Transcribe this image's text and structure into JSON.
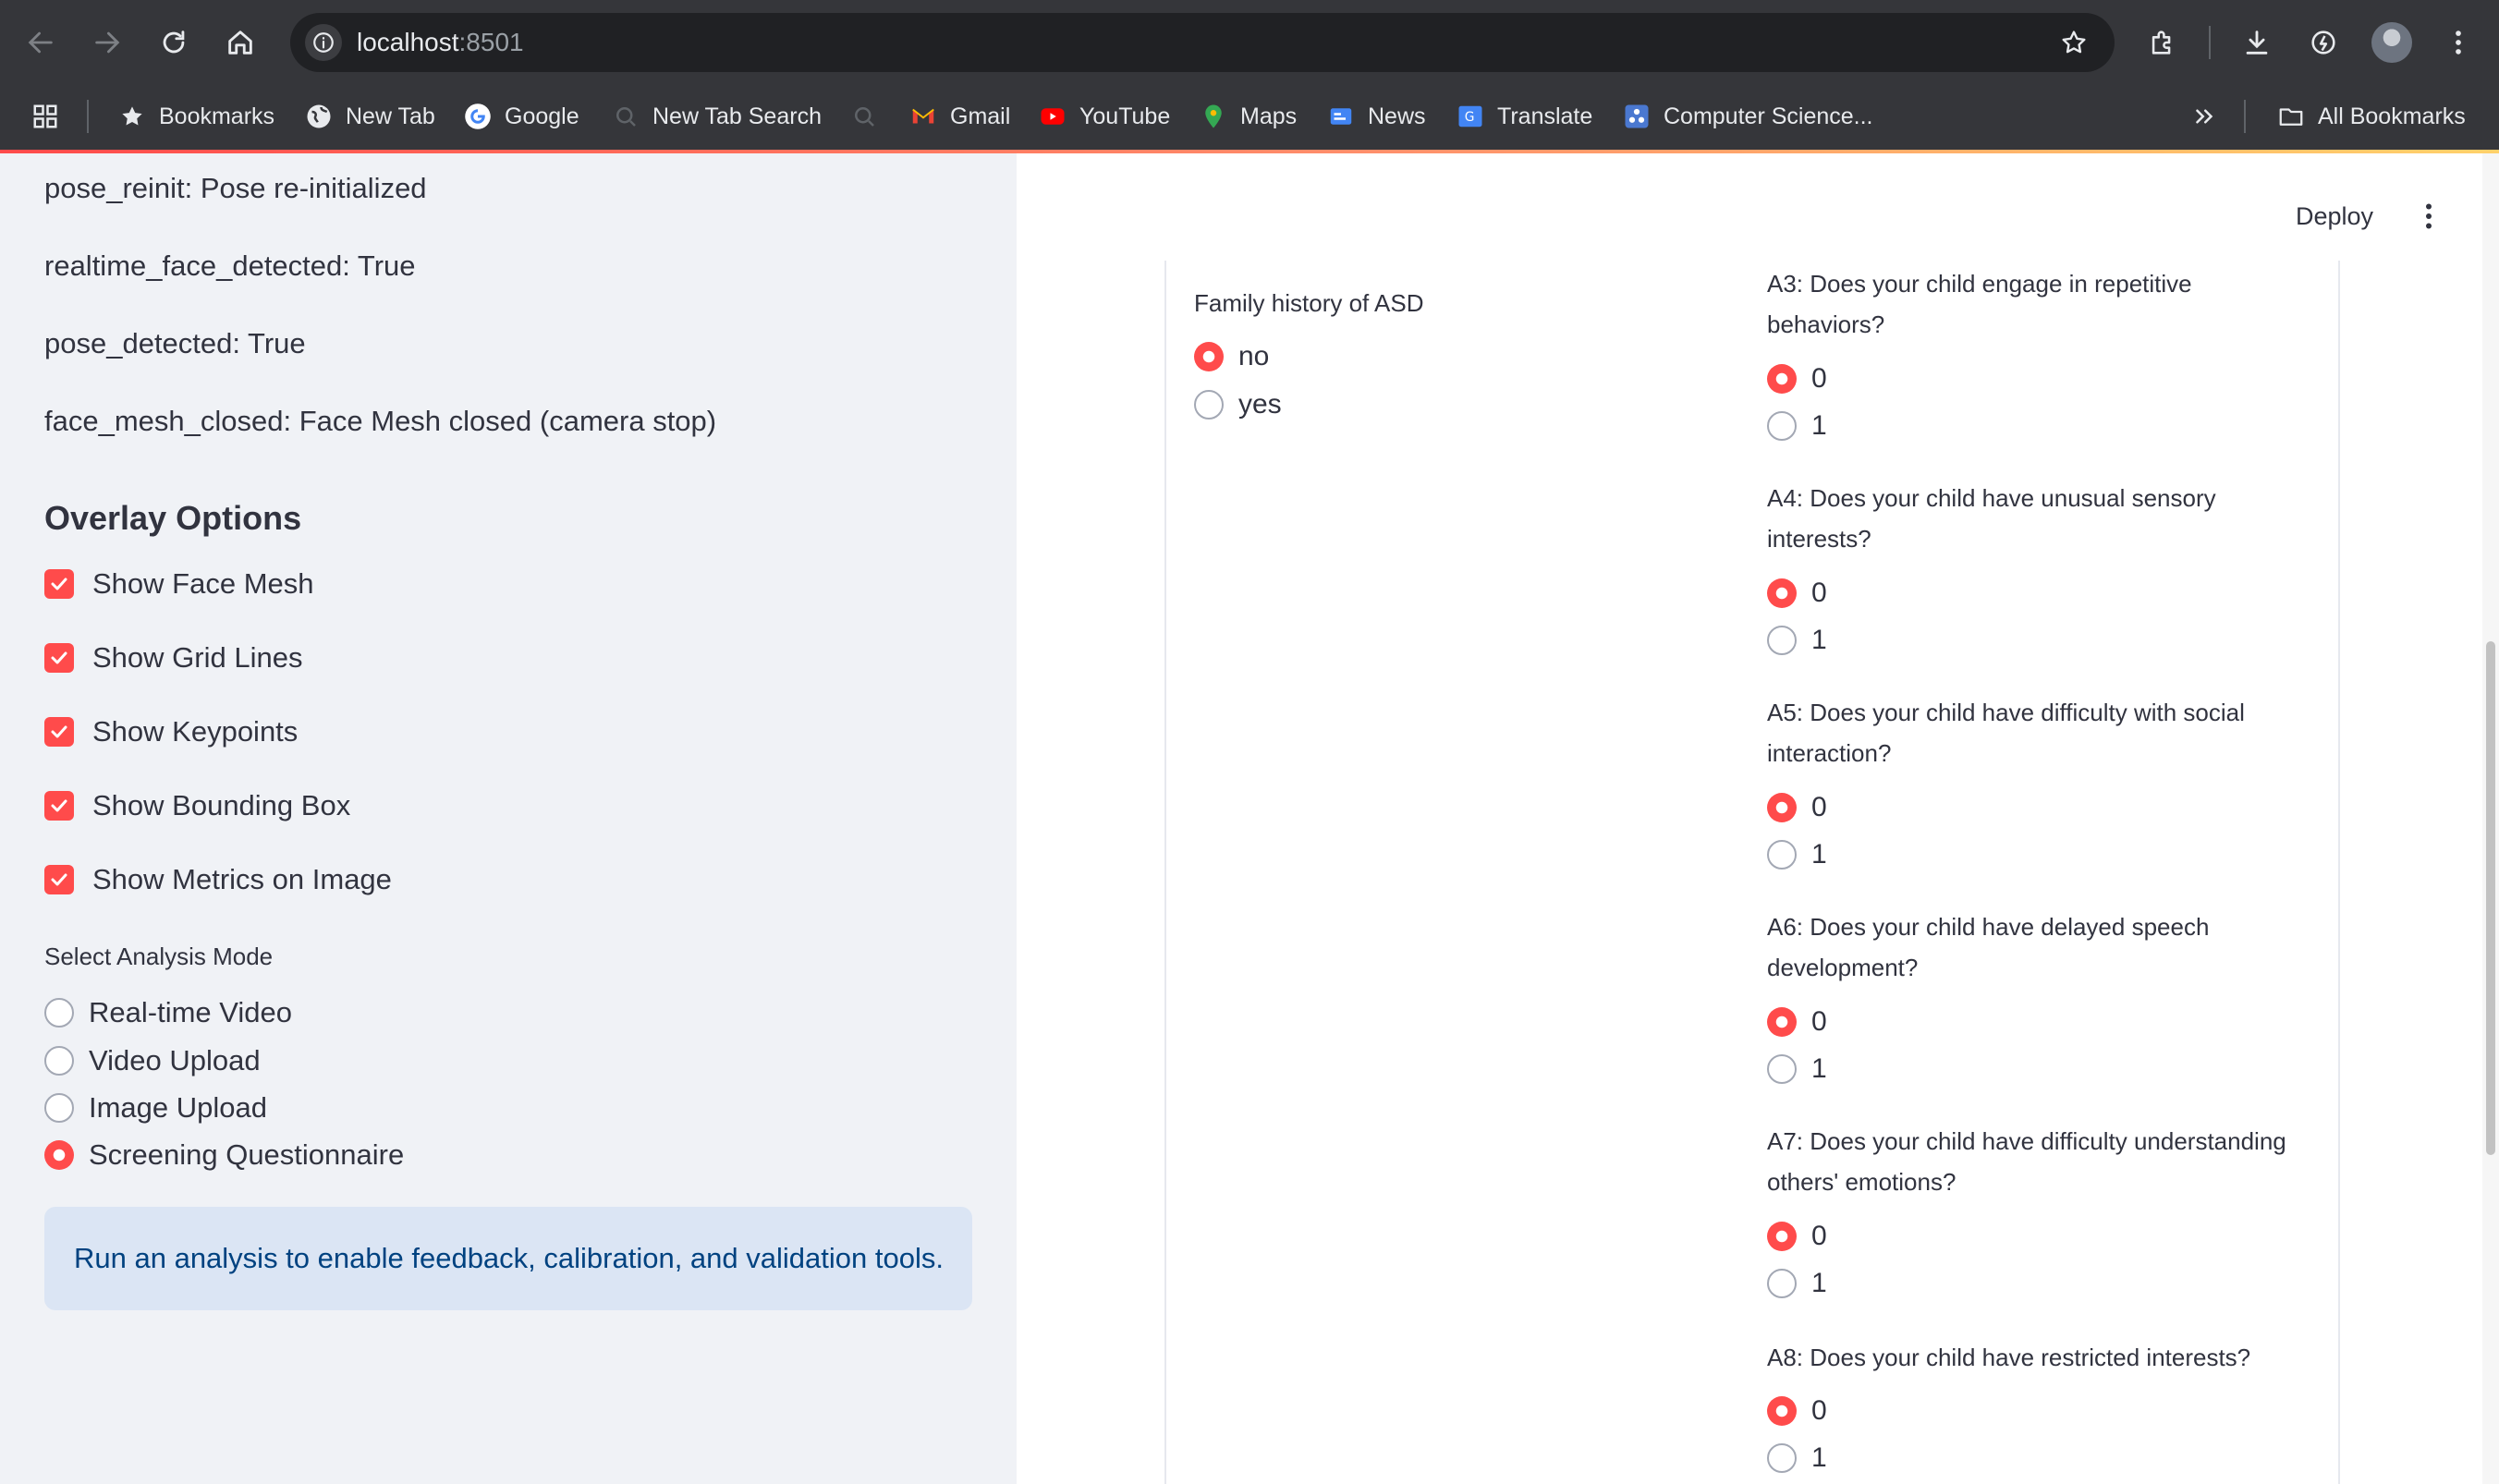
{
  "browser": {
    "url_host": "localhost",
    "url_port": ":8501",
    "bookmarks": [
      "Bookmarks",
      "New Tab",
      "Google",
      "New Tab Search",
      "Gmail",
      "YouTube",
      "Maps",
      "News",
      "Translate",
      "Computer Science..."
    ],
    "all_bookmarks": "All Bookmarks"
  },
  "sidebar": {
    "status_lines": [
      "pose_reinit: Pose re-initialized",
      "realtime_face_detected: True",
      "pose_detected: True",
      "face_mesh_closed: Face Mesh closed (camera stop)"
    ],
    "overlay_title": "Overlay Options",
    "overlay_options": [
      {
        "label": "Show Face Mesh",
        "checked": true
      },
      {
        "label": "Show Grid Lines",
        "checked": true
      },
      {
        "label": "Show Keypoints",
        "checked": true
      },
      {
        "label": "Show Bounding Box",
        "checked": true
      },
      {
        "label": "Show Metrics on Image",
        "checked": true
      }
    ],
    "mode_label": "Select Analysis Mode",
    "modes": [
      {
        "label": "Real-time Video",
        "selected": false
      },
      {
        "label": "Video Upload",
        "selected": false
      },
      {
        "label": "Image Upload",
        "selected": false
      },
      {
        "label": "Screening Questionnaire",
        "selected": true
      }
    ],
    "info_text": "Run an analysis to enable feedback, calibration, and validation tools."
  },
  "header": {
    "deploy_label": "Deploy"
  },
  "form": {
    "family_history": {
      "label": "Family history of ASD",
      "options": [
        "no",
        "yes"
      ],
      "selected": "no"
    },
    "questions": [
      {
        "line1": "A3: Does your child engage in repetitive",
        "line2": "behaviors?",
        "options": [
          "0",
          "1"
        ],
        "selected": "0"
      },
      {
        "line1": "A4: Does your child have unusual sensory",
        "line2": "interests?",
        "options": [
          "0",
          "1"
        ],
        "selected": "0"
      },
      {
        "line1": "A5: Does your child have difficulty with social",
        "line2": "interaction?",
        "options": [
          "0",
          "1"
        ],
        "selected": "0"
      },
      {
        "line1": "A6: Does your child have delayed speech",
        "line2": "development?",
        "options": [
          "0",
          "1"
        ],
        "selected": "0"
      },
      {
        "line1": "A7: Does your child have difficulty understanding",
        "line2": "others' emotions?",
        "options": [
          "0",
          "1"
        ],
        "selected": "0"
      },
      {
        "line1": "A8: Does your child have restricted interests?",
        "line2": "",
        "options": [
          "0",
          "1"
        ],
        "selected": "0"
      }
    ]
  },
  "colors": {
    "accent": "#ff4b4b",
    "sidebar_bg": "#f0f2f6",
    "info_bg": "#dbe5f4",
    "info_text": "#004280",
    "chrome_bg": "#35363a"
  }
}
